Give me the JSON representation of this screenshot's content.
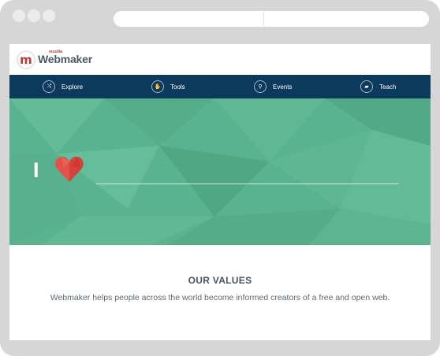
{
  "browser": {
    "window_controls": [
      "dot",
      "dot",
      "dot"
    ]
  },
  "header": {
    "logo_mark": "m",
    "logo_sub": "mozilla",
    "logo_name": "Webmaker"
  },
  "nav": {
    "items": [
      {
        "label": "Explore",
        "icon": "shuffle-icon",
        "glyph": "⤨"
      },
      {
        "label": "Tools",
        "icon": "hand-icon",
        "glyph": "✋"
      },
      {
        "label": "Events",
        "icon": "map-pin-icon",
        "glyph": "⚲"
      },
      {
        "label": "Teach",
        "icon": "book-icon",
        "glyph": "▰"
      }
    ]
  },
  "hero": {
    "text": "I",
    "heart_icon": "heart-icon",
    "colors": {
      "background": "#5ab390",
      "heart": "#d8413a"
    }
  },
  "values": {
    "title": "OUR VALUES",
    "text": "Webmaker helps people across the world become informed creators of a free and open web."
  },
  "colors": {
    "nav": "#0c3a5c",
    "browser_frame": "#d6d6d6",
    "brand_red": "#c13832"
  }
}
